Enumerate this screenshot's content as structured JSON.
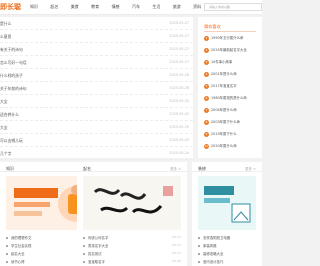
{
  "header": {
    "logo": "即长聪",
    "nav": [
      "知识",
      "起名",
      "美食",
      "教育",
      "情感",
      "汽车",
      "生活",
      "旅游",
      "资料"
    ],
    "search_placeholder": "请输入你感兴趣"
  },
  "main_list": [
    {
      "title": "是什么",
      "date": "2025-05-27"
    },
    {
      "title": "么意思",
      "date": "2025-05-27"
    },
    {
      "title": "有关于的诗句",
      "date": "2025-05-27"
    },
    {
      "title": "怎么写好一句话",
      "date": "2025-05-27"
    },
    {
      "title": "什么样的孩子",
      "date": "2025-05-26"
    },
    {
      "title": "关于年前的诗句",
      "date": "2025-05-26"
    },
    {
      "title": "大全",
      "date": "2025-05-25"
    },
    {
      "title": "适合养什么",
      "date": "2025-05-25"
    },
    {
      "title": "大全",
      "date": "2025-05-25"
    },
    {
      "title": "可以去哪儿玩",
      "date": "2025-05-25"
    },
    {
      "title": "几个字",
      "date": "2025-05-24"
    }
  ],
  "sidebar": {
    "title": "猜你喜欢",
    "items": [
      "1990年五行属什么命",
      "2025年最新起名字大全",
      "10件事小故事",
      "2001年是什么命",
      "2017年宝宝名字",
      "1980年属相的是什么命",
      "2004年是什么命",
      "2003年属于什么命",
      "2019年属于什么",
      "2020年属什么命"
    ]
  },
  "columns": [
    {
      "title": "知识",
      "more": "更多 >",
      "items": [
        {
          "title": "我的理想作文",
          "date": "05-27"
        },
        {
          "title": "学生社会实践",
          "date": "05-27"
        },
        {
          "title": "起名大全",
          "date": "05-27"
        },
        {
          "title": "读书心得",
          "date": "05-26"
        },
        {
          "title": "家庭教育",
          "date": "05-26"
        }
      ]
    },
    {
      "title": "起名",
      "more": "更多 >",
      "items": [
        {
          "title": "传统公司名字",
          "date": "05-27"
        },
        {
          "title": "男孩名字大全",
          "date": "05-27"
        },
        {
          "title": "姓名测试",
          "date": "05-27"
        },
        {
          "title": "宝宝取名字",
          "date": "05-26"
        },
        {
          "title": "吉祥名字",
          "date": "05-26"
        }
      ]
    },
    {
      "title": "装修",
      "more": "更多 >",
      "items": [
        {
          "title": "怎样选购厨卫电器",
          "date": "05-27"
        },
        {
          "title": "家装风格",
          "date": "05-27"
        },
        {
          "title": "装修攻略大全",
          "date": "05-27"
        },
        {
          "title": "室内设计技巧",
          "date": "05-26"
        },
        {
          "title": "墙面装修指南",
          "date": "05-26"
        }
      ]
    }
  ],
  "colors": {
    "accent": "#ee6b18"
  }
}
